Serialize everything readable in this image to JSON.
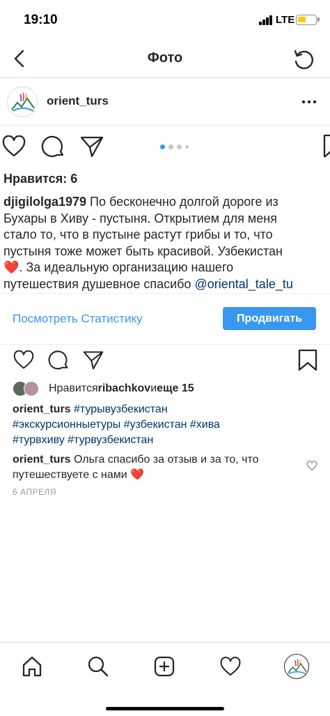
{
  "status_bar": {
    "time": "19:10",
    "network": "LTE"
  },
  "header": {
    "title": "Фото",
    "back_icon": "chevron-left-icon",
    "refresh_icon": "refresh-icon"
  },
  "post": {
    "username": "orient_turs",
    "more_icon": "more-horizontal-icon",
    "likes_text": "Нравится: 6",
    "caption_user": "djigilolga1979",
    "caption_lines": [
      " По бесконечно долгой дороге из",
      "Бухары в Хиву - пустыня. Открытием для меня",
      "стало то, что в пустыне растут грибы и то, что",
      "пустыня тоже может быть красивой. Узбекистан",
      ". За идеальную организацию нашего",
      "путешествия душевное спасибо "
    ],
    "caption_heart": "❤️",
    "caption_mention": "@oriental_tale_tu",
    "carousel_dots": 4
  },
  "insights": {
    "link_label": "Посмотреть Статистику",
    "promote_label": "Продвигать"
  },
  "liked_by": {
    "prefix": "Нравится ",
    "user": "ribachkov",
    "middle": " и ",
    "others": "еще 15"
  },
  "repost_caption": {
    "user": "orient_turs",
    "tags_line1": " #турывузбекистан",
    "tags_line2": "#экскурсионныетуры #узбекистан #хива",
    "tags_line3": "#турвхиву #турвузбекистан"
  },
  "comment": {
    "user": "orient_turs",
    "text_line1": " Ольга спасибо за отзыв и за то, что",
    "text_line2": "путешествуете с нами ",
    "heart": "❤️"
  },
  "date": "6 АПРЕЛЯ",
  "colors": {
    "accent": "#3897f0",
    "text": "#262626",
    "link": "#003569",
    "muted": "#999999"
  }
}
